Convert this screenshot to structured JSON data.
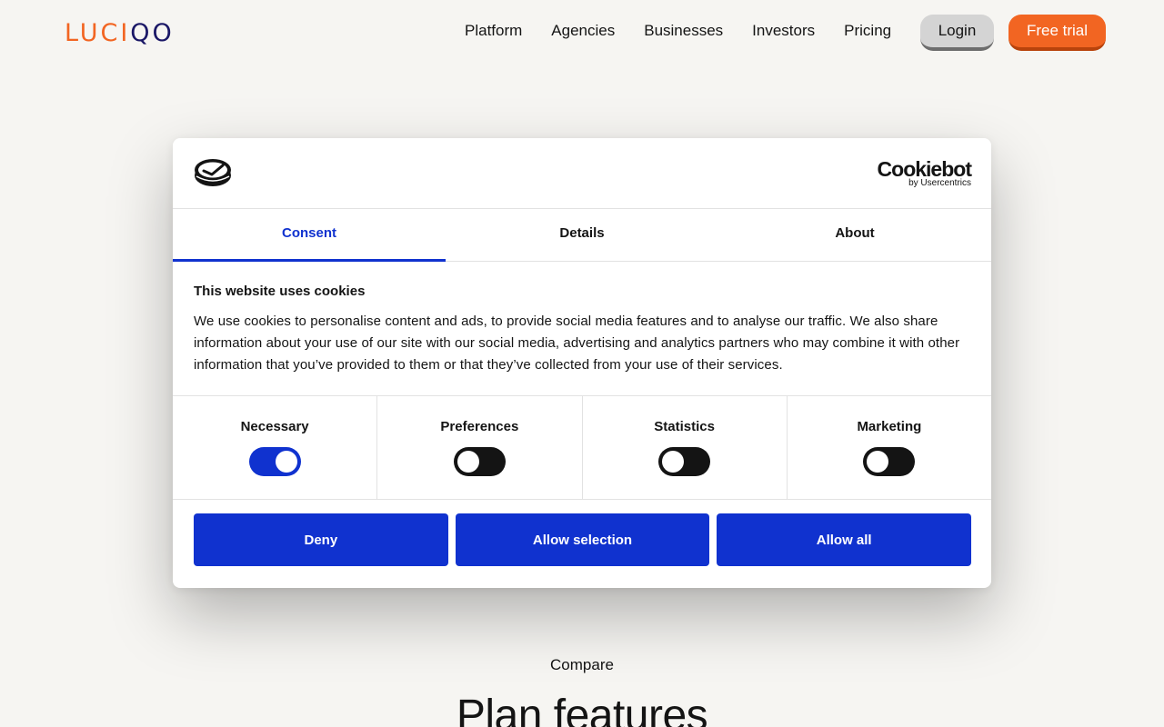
{
  "nav": {
    "logo_part1": "LUCI",
    "logo_part2": "QO",
    "links": [
      "Platform",
      "Agencies",
      "Businesses",
      "Investors",
      "Pricing"
    ],
    "login_label": "Login",
    "trial_label": "Free trial"
  },
  "colors": {
    "brand_orange": "#f26522",
    "brand_navy": "#1a1766",
    "cookiebot_blue": "#1032cf"
  },
  "page": {
    "compare_label": "Compare",
    "plan_heading": "Plan features"
  },
  "dialog": {
    "provider_name": "Cookiebot",
    "provider_sub": "by Usercentrics",
    "tabs": [
      {
        "label": "Consent",
        "active": true
      },
      {
        "label": "Details",
        "active": false
      },
      {
        "label": "About",
        "active": false
      }
    ],
    "title": "This website uses cookies",
    "text": "We use cookies to personalise content and ads, to provide social media features and to analyse our traffic. We also share information about your use of our site with our social media, advertising and analytics partners who may combine it with other information that you’ve provided to them or that they’ve collected from your use of their services.",
    "toggles": [
      {
        "label": "Necessary",
        "on": true
      },
      {
        "label": "Preferences",
        "on": false
      },
      {
        "label": "Statistics",
        "on": false
      },
      {
        "label": "Marketing",
        "on": false
      }
    ],
    "buttons": {
      "deny": "Deny",
      "allow_selection": "Allow selection",
      "allow_all": "Allow all"
    }
  }
}
